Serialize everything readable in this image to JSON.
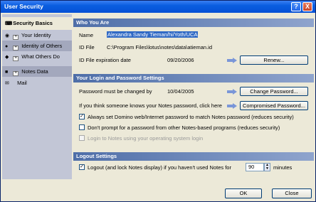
{
  "window": {
    "title": "User Security"
  },
  "title_buttons": {
    "help": "?",
    "close": "X"
  },
  "sidebar": {
    "items": [
      {
        "label": "Security Basics"
      },
      {
        "label": "Your Identity"
      },
      {
        "label": "Identity of Others"
      },
      {
        "label": "What Others Do"
      },
      {
        "label": "Notes Data"
      },
      {
        "label": "Mail"
      }
    ]
  },
  "who": {
    "heading": "Who You Are",
    "name_label": "Name",
    "name_value": "Alexandra Sandy Tieman/hi/Yoth/UCA",
    "idfile_label": "ID File",
    "idfile_value": "C:\\Program Files\\lotus\\notes\\data\\atieman.id",
    "expiry_label": "ID File expiration date",
    "expiry_value": "09/20/2006",
    "renew_button": "Renew..."
  },
  "login": {
    "heading": "Your Login and Password Settings",
    "change_label": "Password must be changed by",
    "change_value": "10/04/2005",
    "change_button": "Change Password...",
    "comp_label": "If you think someone knows your Notes password, click here",
    "comp_button": "Compromised Password...",
    "cb1_label": "Always set Domino web/Internet password to match Notes password (reduces security)",
    "cb1_checked": true,
    "cb2_label": "Don't prompt for a password from other Notes-based programs (reduces security)",
    "cb2_checked": false,
    "cb3_label": "Login to Notes using your operating system login",
    "cb3_checked": false
  },
  "logout": {
    "heading": "Logout Settings",
    "label": "Logout (and lock Notes display) if you haven't used Notes for",
    "checked": true,
    "minutes_value": "90",
    "minutes_unit": "minutes"
  },
  "footer": {
    "ok": "OK",
    "close": "Close"
  },
  "colors": {
    "titlebar": "#0550d6",
    "section_head": "#4e6ea8",
    "selection": "#316ac5"
  }
}
